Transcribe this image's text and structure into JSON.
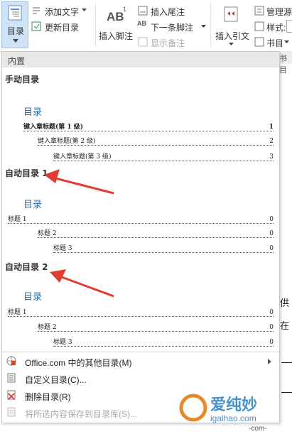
{
  "ribbon": {
    "toc_label": "目录",
    "add_text": "添加文字",
    "update_toc": "更新目录",
    "insert_footnote": "插入脚注",
    "insert_endnote": "插入尾注",
    "next_footnote": "下一条脚注",
    "show_notes": "显示备注",
    "insert_citation": "插入引文",
    "manage_sources": "管理源",
    "style": "样式:",
    "bibliography": "书目",
    "ab_glyph": "AB",
    "ab_sup": "1",
    "ab_small": "AB"
  },
  "dropdown": {
    "header": "内置",
    "manual": {
      "title": "手动目录",
      "heading": "目录",
      "entries": [
        {
          "text": "键入章标题(第 1 级)",
          "page": "1"
        },
        {
          "text": "键入章标题(第 2 级)",
          "page": "2"
        },
        {
          "text": "键入章标题(第 3 级)",
          "page": "3"
        }
      ]
    },
    "auto1": {
      "title": "自动目录 1",
      "heading": "目录",
      "entries": [
        {
          "text": "标题 1",
          "page": "0"
        },
        {
          "text": "标题 2",
          "page": "0"
        },
        {
          "text": "标题 3",
          "page": "0"
        }
      ]
    },
    "auto2": {
      "title": "自动目录 2",
      "heading": "目录",
      "entries": [
        {
          "text": "标题 1",
          "page": "0"
        },
        {
          "text": "标题 2",
          "page": "0"
        },
        {
          "text": "标题 3",
          "page": "0"
        }
      ]
    },
    "menu": [
      {
        "label": "Office.com 中的其他目录(M)",
        "icon": "office-globe-icon"
      },
      {
        "label": "自定义目录(C)...",
        "icon": "custom-toc-icon"
      },
      {
        "label": "删除目录(R)",
        "icon": "delete-toc-icon"
      },
      {
        "label": "将所选内容保存到目录库(S)...",
        "icon": "save-selection-icon"
      }
    ]
  },
  "document": {
    "tab_fragment": "书目",
    "text1": "供",
    "text2": "在"
  },
  "watermark": {
    "brand": "爱纯妙",
    "site": "igalhao.com",
    "site2": "-com-"
  },
  "colors": {
    "accent": "#2e6da4",
    "arrow": "#e03c31",
    "header_bg": "#e8e8e8"
  }
}
